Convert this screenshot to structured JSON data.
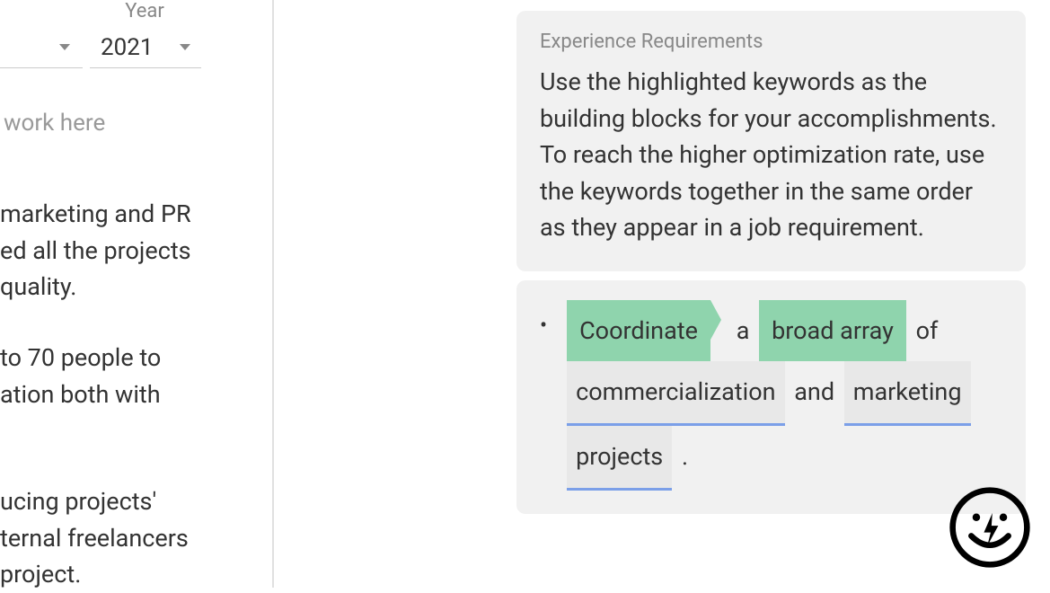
{
  "left": {
    "year_label": "Year",
    "year_value": "2021",
    "work_here_placeholder": "work here",
    "paragraphs": [
      "marketing and PR\ned all the projects\nquality.",
      " to 70 people to\nation both with",
      "ucing projects'\nternal freelancers\nproject."
    ]
  },
  "tips": {
    "title": "Experience Requirements",
    "body": "Use the highlighted keywords as the building blocks for your accomplishments. To reach the higher optimization rate, use the keywords together in the same order as they appear in a job requirement."
  },
  "keywords": {
    "items": [
      {
        "type": "green_arrow",
        "text": "Coordinate"
      },
      {
        "type": "plain",
        "text": "a"
      },
      {
        "type": "green",
        "text": "broad array"
      },
      {
        "type": "plain",
        "text": "of"
      },
      {
        "type": "gray",
        "text": "commercialization"
      },
      {
        "type": "plain",
        "text": "and"
      },
      {
        "type": "gray",
        "text": "marketing"
      },
      {
        "type": "gray",
        "text": "projects"
      },
      {
        "type": "plain",
        "text": "."
      }
    ]
  }
}
